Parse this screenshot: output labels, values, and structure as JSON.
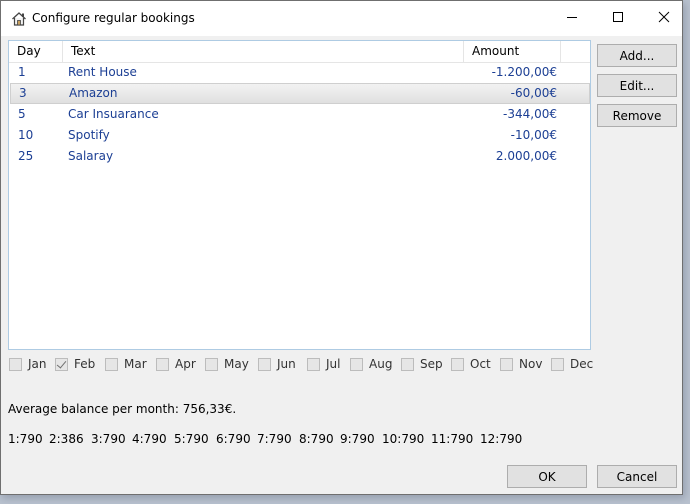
{
  "window": {
    "title": "Configure regular bookings",
    "icon": "home-icon",
    "controls": [
      "minimize-icon",
      "maximize-icon",
      "close-icon"
    ]
  },
  "list": {
    "columns": [
      "Day",
      "Text",
      "Amount"
    ],
    "rows": [
      {
        "day": "1",
        "text": "Rent House",
        "amount": "-1.200,00€",
        "selected": false
      },
      {
        "day": "3",
        "text": "Amazon",
        "amount": "-60,00€",
        "selected": true
      },
      {
        "day": "5",
        "text": "Car Insuarance",
        "amount": "-344,00€",
        "selected": false
      },
      {
        "day": "10",
        "text": "Spotify",
        "amount": "-10,00€",
        "selected": false
      },
      {
        "day": "25",
        "text": "Salaray",
        "amount": "2.000,00€",
        "selected": false
      }
    ]
  },
  "buttons": {
    "add": "Add...",
    "edit": "Edit...",
    "remove": "Remove",
    "ok": "OK",
    "cancel": "Cancel"
  },
  "months": [
    {
      "label": "Jan",
      "checked": false
    },
    {
      "label": "Feb",
      "checked": true
    },
    {
      "label": "Mar",
      "checked": false
    },
    {
      "label": "Apr",
      "checked": false
    },
    {
      "label": "May",
      "checked": false
    },
    {
      "label": "Jun",
      "checked": false
    },
    {
      "label": "Jul",
      "checked": false
    },
    {
      "label": "Aug",
      "checked": false
    },
    {
      "label": "Sep",
      "checked": false
    },
    {
      "label": "Oct",
      "checked": false
    },
    {
      "label": "Nov",
      "checked": false
    },
    {
      "label": "Dec",
      "checked": false
    }
  ],
  "summary": {
    "average_text": "Average balance per month: 756,33€.",
    "monthly_balances": [
      "1:790",
      "2:386",
      "3:790",
      "4:790",
      "5:790",
      "6:790",
      "7:790",
      "8:790",
      "9:790",
      "10:790",
      "11:790",
      "12:790"
    ]
  },
  "colors": {
    "row_text": "#1c3f94",
    "list_border": "#aecbe3"
  }
}
